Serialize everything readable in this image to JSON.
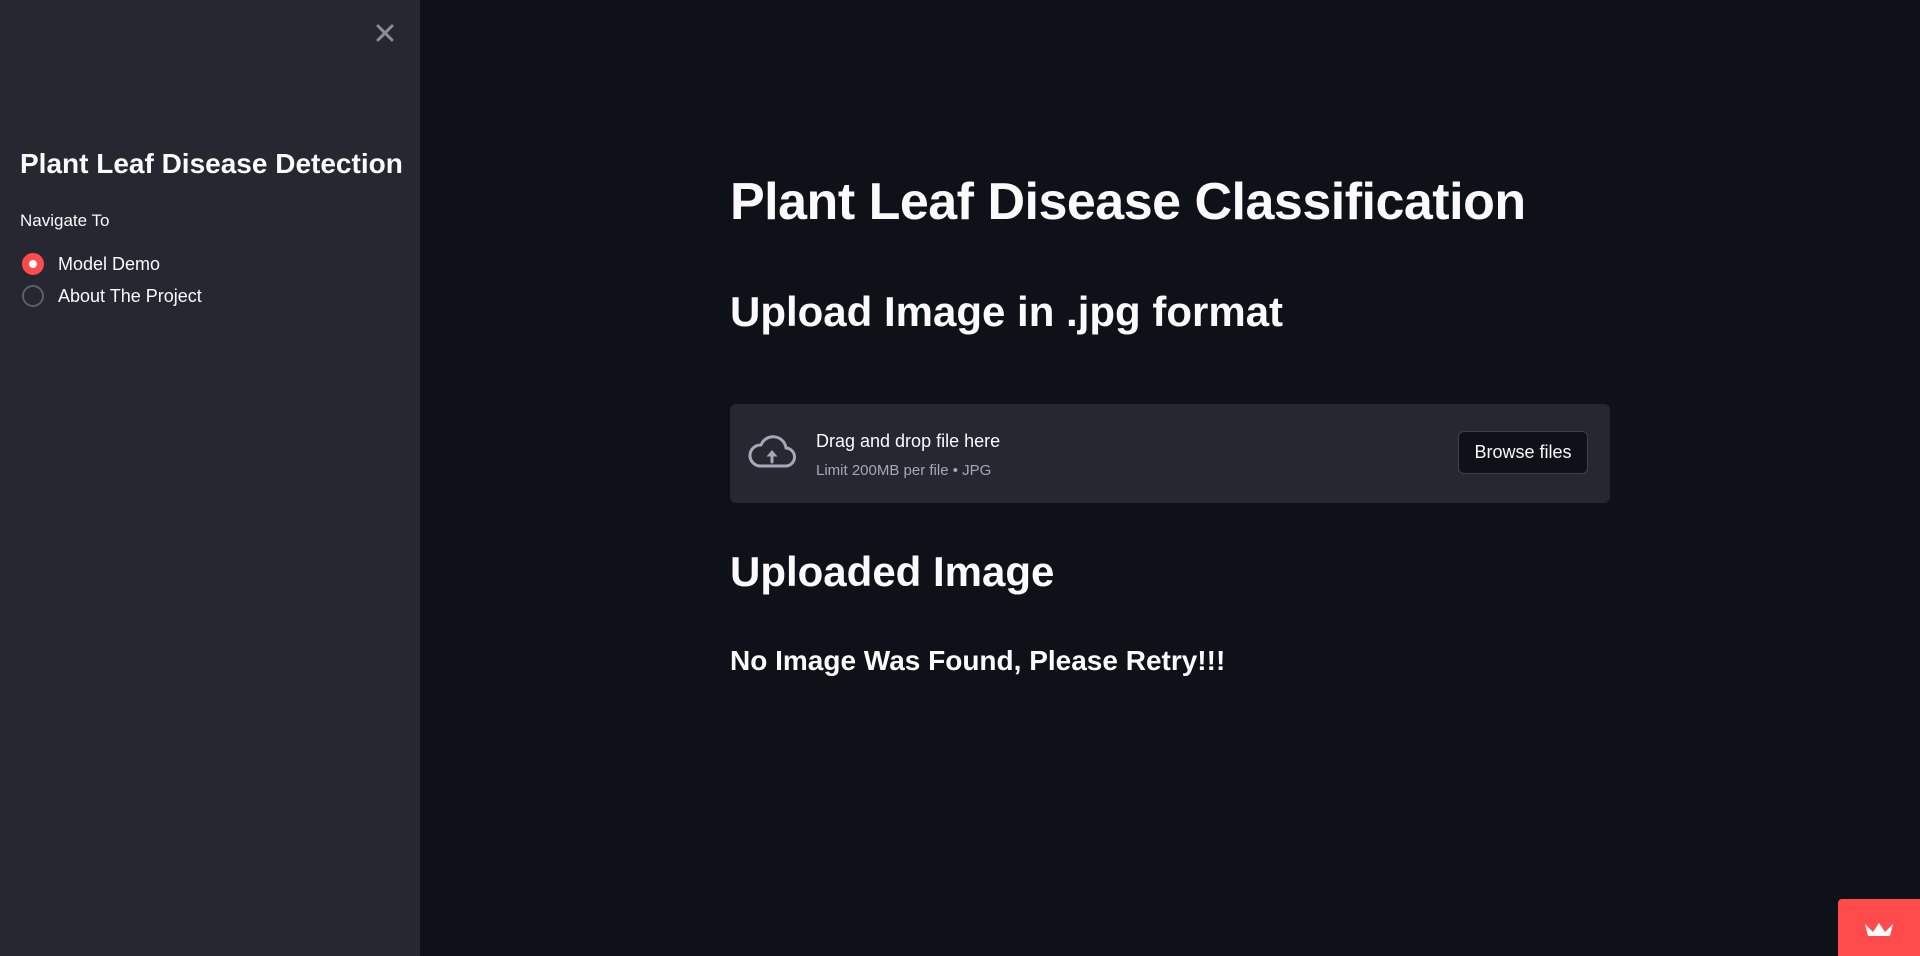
{
  "sidebar": {
    "title": "Plant Leaf Disease Detection",
    "nav_label": "Navigate To",
    "options": [
      {
        "label": "Model Demo",
        "selected": true
      },
      {
        "label": "About The Project",
        "selected": false
      }
    ]
  },
  "main": {
    "title": "Plant Leaf Disease Classification",
    "upload_header": "Upload Image in .jpg format",
    "uploader": {
      "drop_text": "Drag and drop file here",
      "limit_text": "Limit 200MB per file • JPG",
      "browse_label": "Browse files"
    },
    "uploaded_header": "Uploaded Image",
    "status_message": "No Image Was Found, Please Retry!!!"
  },
  "colors": {
    "accent": "#ff4b4b",
    "background": "#0e1117",
    "sidebar_background": "#262730",
    "text": "#fafafa",
    "muted_text": "#a3a8b8"
  },
  "icons": {
    "close": "close-icon",
    "upload": "cloud-upload-icon",
    "badge": "streamlit-crown-icon"
  }
}
